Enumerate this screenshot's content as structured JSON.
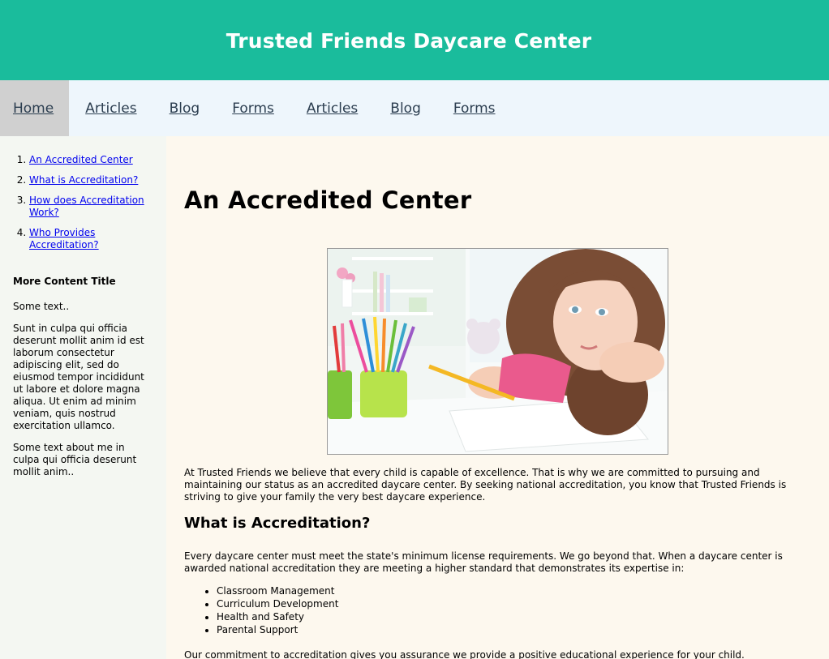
{
  "header": {
    "title": "Trusted Friends Daycare Center"
  },
  "nav": {
    "items": [
      {
        "label": "Home"
      },
      {
        "label": "Articles"
      },
      {
        "label": "Blog"
      },
      {
        "label": "Forms"
      },
      {
        "label": "Articles"
      },
      {
        "label": "Blog"
      },
      {
        "label": "Forms"
      }
    ]
  },
  "sidebar": {
    "toc": [
      {
        "label": "An Accredited Center"
      },
      {
        "label": "What is Accreditation?"
      },
      {
        "label": "How does Accreditation Work?"
      },
      {
        "label": "Who Provides Accreditation?"
      }
    ],
    "more_title": "More Content Title",
    "paragraphs": [
      "Some text..",
      "Sunt in culpa qui officia deserunt mollit anim id est laborum consectetur adipiscing elit, sed do eiusmod tempor incididunt ut labore et dolore magna aliqua. Ut enim ad minim veniam, quis nostrud exercitation ullamco.",
      "Some text about me in culpa qui officia deserunt mollit anim.."
    ]
  },
  "main": {
    "title": "An Accredited Center",
    "intro": "At Trusted Friends we believe that every child is capable of excellence. That is why we are committed to pursuing and maintaining our status as an accredited daycare center. By seeking national accreditation, you know that Trusted Friends is striving to give your family the very best daycare experience.",
    "section_title": "What is Accreditation?",
    "section_text": "Every daycare center must meet the state's minimum license requirements. We go beyond that. When a daycare center is awarded national accreditation they are meeting a higher standard that demonstrates its expertise in:",
    "list": [
      "Classroom Management",
      "Curriculum Development",
      "Health and Safety",
      "Parental Support"
    ],
    "closing": "Our commitment to accreditation gives you assurance we provide a positive educational experience for your child."
  },
  "colors": {
    "header_bg": "#1abc9c",
    "nav_bg": "#eef6fc",
    "nav_active_bg": "#d0d0d0",
    "sidebar_bg": "#f4f7f2",
    "main_bg": "#fdf8ee",
    "link": "#0000ee"
  }
}
